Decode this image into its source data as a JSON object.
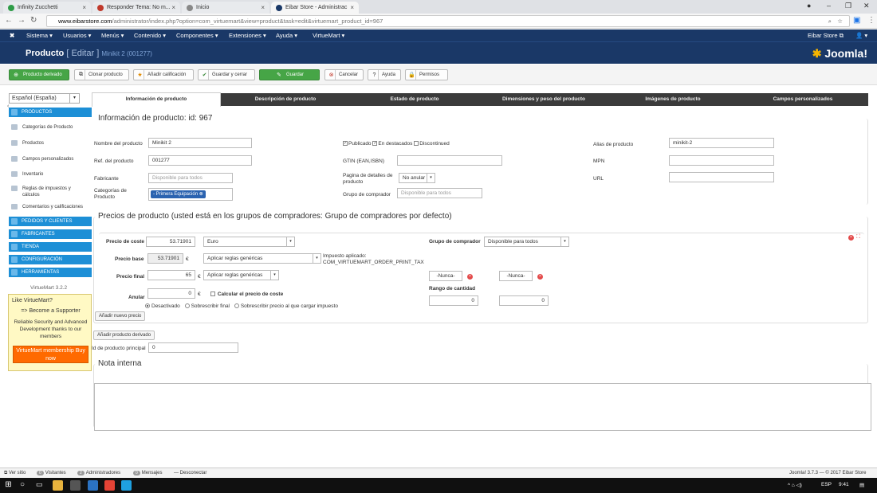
{
  "browser": {
    "tabs": [
      {
        "label": "Infinity Zucchetti",
        "color": "#2e9c47"
      },
      {
        "label": "Responder Tema: No m...",
        "color": "#c0392b"
      },
      {
        "label": "Inicio",
        "color": "#888888"
      },
      {
        "label": "Eibar Store - Administrac",
        "color": "#1a3867"
      }
    ],
    "url_domain": "www.eibarstore.com",
    "url_path": "/administrator/index.php?option=com_virtuemart&view=product&task=edit&virtuemart_product_id=967"
  },
  "topnav": {
    "items": [
      "Sistema ▾",
      "Usuarios ▾",
      "Menús ▾",
      "Contenido ▾",
      "Componentes ▾",
      "Extensiones ▾",
      "Ayuda ▾",
      "VirtueMart ▾"
    ],
    "site_link": "Eibar Store ⧉",
    "user": "👤 ▾"
  },
  "header": {
    "title": "Producto",
    "edit": "[ Editar ]",
    "subtitle": "Minikit 2 (001277)",
    "logo": "Joomla!"
  },
  "toolbar": {
    "derived": "Producto derivado",
    "clone": "Clonar producto",
    "rating": "Añadir calificación",
    "save_close": "Guardar y cerrar",
    "save": "Guardar",
    "cancel": "Cancelar",
    "help": "Ayuda",
    "permissions": "Permisos"
  },
  "sidebar": {
    "language": "Español (España)",
    "section_products": "PRODUCTOS",
    "items": [
      "Categorías de Producto",
      "Productos",
      "Campos personalizados",
      "Inventario",
      "Reglas de impuestos y cálculos",
      "Comentarios y calificaciones"
    ],
    "sections": [
      "PEDIDOS Y CLIENTES",
      "FABRICANTES",
      "TIENDA",
      "CONFIGURACIÓN",
      "HERRAMIENTAS"
    ],
    "version": "VirtueMart 3.2.2",
    "promo": {
      "title": "Like VirtueMart?",
      "supporter": "=> Become a Supporter",
      "text": "Reliable Security and Advanced Development thanks to our members",
      "buy": "VirtueMart membership Buy now"
    }
  },
  "tabs": [
    "Información de producto",
    "Descripción de producto",
    "Estado de producto",
    "Dimensiones y peso del producto",
    "Imágenes de producto",
    "Campos personalizados"
  ],
  "info": {
    "heading": "Información de producto: id: 967",
    "name_label": "Nombre del producto",
    "name_value": "Minikit 2",
    "sku_label": "Ref. del producto",
    "sku_value": "001277",
    "manufacturer_label": "Fabricante",
    "manufacturer_placeholder": "Disponible para todos",
    "categories_label": "Categorías de Producto",
    "category_tag": "- Primera Equipación",
    "published": "Publicado",
    "featured": "En destacados",
    "discontinued": "Discontinued",
    "gtin_label": "GTIN (EAN,ISBN)",
    "detail_page_label": "Pagina de detalles de producto",
    "detail_page_value": "No anular",
    "shopper_group_label": "Grupo de comprador",
    "shopper_group_placeholder": "Disponible para todos",
    "alias_label": "Alias de producto",
    "alias_value": "minikit-2",
    "mpn_label": "MPN",
    "url_label": "URL"
  },
  "prices": {
    "heading": "Precios de producto (usted está en los grupos de compradores: Grupo de compradores por defecto)",
    "cost_label": "Precio de coste",
    "cost_value": "53.71901",
    "currency": "Euro",
    "shopper_group_label": "Grupo de comprador",
    "shopper_group_value": "Disponible para todos",
    "base_label": "Precio base",
    "base_value": "53.71901",
    "euro": "€",
    "rules1": "Aplicar reglas genéricas",
    "tax_applied": "Impuesto aplicado:",
    "tax_code": "COM_VIRTUEMART_ORDER_PRINT_TAX",
    "final_label": "Precio final",
    "final_value": "65",
    "rules2": "Aplicar reglas genéricas",
    "never1": "-Nunca-",
    "never2": "-Nunca-",
    "quantity_range": "Rango de cantidad",
    "qty_from": "0",
    "qty_to": "0",
    "override_label": "Anular",
    "override_value": "0",
    "calc_cost": "Calcular el precio de coste",
    "opt_disabled": "Desactivado",
    "opt_override": "Sobrescribir final",
    "opt_pretax": "Sobrescribir precio al que cargar impuesto",
    "add_price": "Añadir nuevo precio"
  },
  "derived_btn": "Añadir producto derivado",
  "parent_label": "Id de producto principal",
  "parent_value": "0",
  "notes_heading": "Nota interna",
  "status": {
    "view_site": "Ver sitio",
    "visitors_count": "0",
    "visitors": "Visitantes",
    "admins_count": "2",
    "admins": "Administradores",
    "messages_count": "0",
    "messages": "Mensajes",
    "logout": "Desconectar",
    "version": "Joomla! 3.7.3 — © 2017 Eibar Store"
  },
  "taskbar": {
    "lang": "ESP",
    "time": "9:41"
  }
}
